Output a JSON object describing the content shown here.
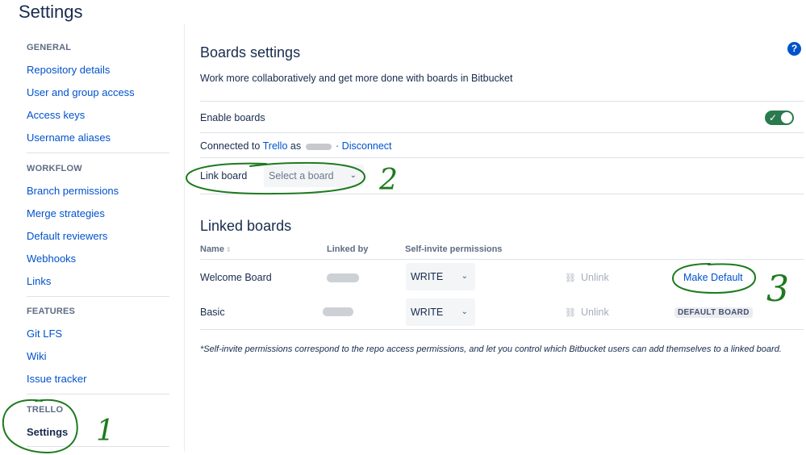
{
  "page": {
    "title": "Settings"
  },
  "sidebar": {
    "sections": [
      {
        "heading": "GENERAL",
        "items": [
          "Repository details",
          "User and group access",
          "Access keys",
          "Username aliases"
        ]
      },
      {
        "heading": "WORKFLOW",
        "items": [
          "Branch permissions",
          "Merge strategies",
          "Default reviewers",
          "Webhooks",
          "Links"
        ]
      },
      {
        "heading": "FEATURES",
        "items": [
          "Git LFS",
          "Wiki",
          "Issue tracker"
        ]
      },
      {
        "heading": "TRELLO",
        "items": [
          "Settings"
        ]
      }
    ]
  },
  "boards_settings": {
    "title": "Boards settings",
    "description": "Work more collaboratively and get more done with boards in Bitbucket",
    "help_glyph": "?",
    "enable_label": "Enable boards",
    "enable_on": true,
    "toggle_check": "✓",
    "connected_prefix": "Connected to ",
    "connected_service": "Trello",
    "connected_as": " as ",
    "disconnect": "· Disconnect",
    "link_board_label": "Link board",
    "link_board_placeholder": "Select a board",
    "select_chevron": "⌄"
  },
  "linked_boards": {
    "title": "Linked boards",
    "columns": {
      "name": "Name",
      "sort_glyph": "⇕",
      "linked_by": "Linked by",
      "permissions": "Self-invite permissions"
    },
    "rows": [
      {
        "name": "Welcome Board",
        "permission": "WRITE",
        "unlink": "Unlink",
        "action": "Make Default"
      },
      {
        "name": "Basic",
        "permission": "WRITE",
        "unlink": "Unlink",
        "badge": "DEFAULT BOARD"
      }
    ],
    "unlink_glyph": "⛓",
    "footnote": "*Self-invite permissions correspond to the repo access permissions, and let you control which Bitbucket users can add themselves to a linked board."
  },
  "annotations": [
    "1",
    "2",
    "3"
  ],
  "colors": {
    "link": "#0052cc",
    "toggle_on": "#2a7a4d",
    "annotation": "#1e7a1e"
  }
}
